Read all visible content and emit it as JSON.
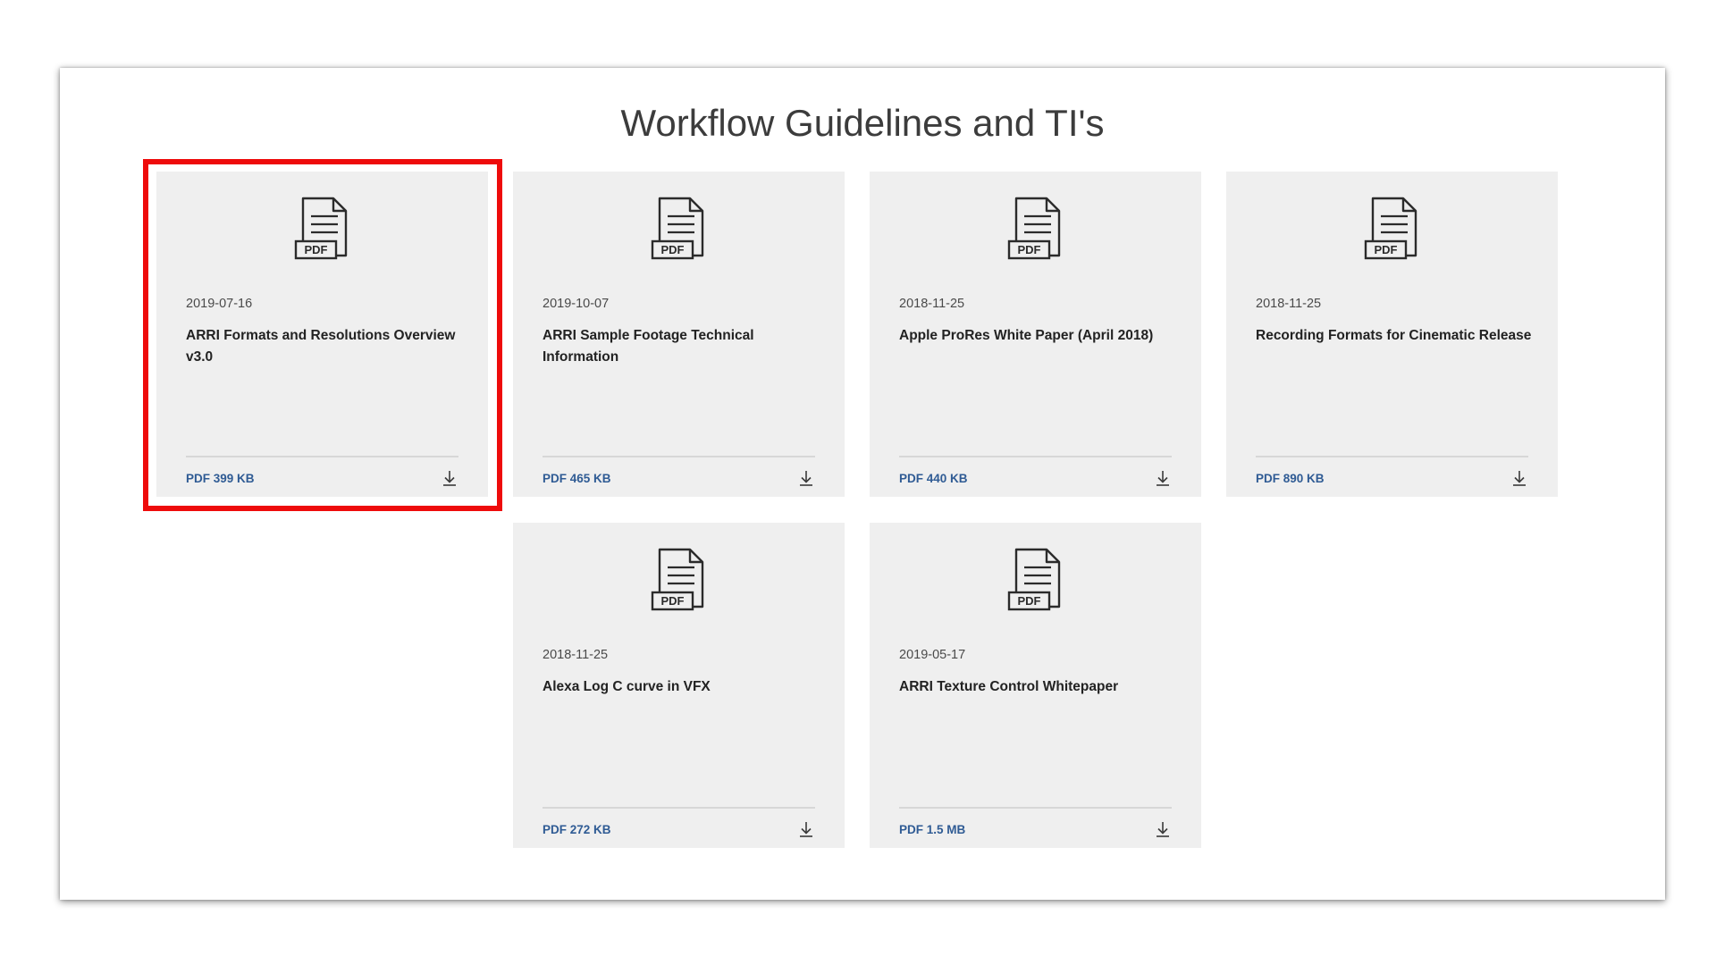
{
  "section": {
    "title": "Workflow Guidelines and TI's"
  },
  "icons": {
    "document": "pdf-document-icon",
    "pdf_badge": "PDF",
    "download": "download-icon"
  },
  "colors": {
    "card_background": "#efefef",
    "file_link": "#2f5b94",
    "highlight": "#ee0b0b"
  },
  "documents": [
    {
      "date": "2019-07-16",
      "title": "ARRI Formats and Resolutions Overview v3.0",
      "file": "PDF 399 KB",
      "highlighted": true
    },
    {
      "date": "2019-10-07",
      "title": "ARRI Sample Footage Technical Information",
      "file": "PDF 465 KB",
      "highlighted": false
    },
    {
      "date": "2018-11-25",
      "title": "Apple ProRes White Paper (April 2018)",
      "file": "PDF 440 KB",
      "highlighted": false
    },
    {
      "date": "2018-11-25",
      "title": "Recording Formats for Cinematic Release",
      "file": "PDF 890 KB",
      "highlighted": false
    },
    {
      "date": "2018-11-25",
      "title": "Alexa Log C curve in VFX",
      "file": "PDF 272 KB",
      "highlighted": false
    },
    {
      "date": "2019-05-17",
      "title": "ARRI Texture Control Whitepaper",
      "file": "PDF 1.5 MB",
      "highlighted": false
    }
  ]
}
